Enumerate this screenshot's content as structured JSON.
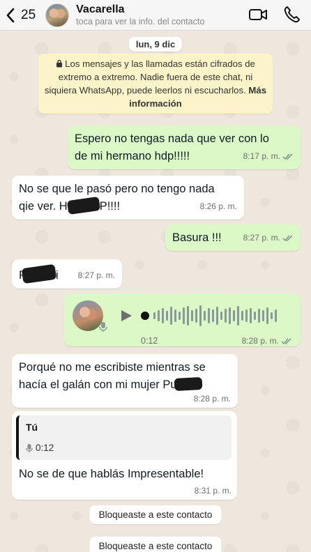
{
  "header": {
    "back_count": "25",
    "contact_name": "Vacarella",
    "contact_subtitle": "toca para ver la info. del contacto"
  },
  "date_separator": "lun, 9 dic",
  "encryption_notice": {
    "text": "Los mensajes y las llamadas están cifrados de extremo a extremo. Nadie fuera de este chat, ni siquiera WhatsApp, puede leerlos ni escucharlos.",
    "link": "Más información"
  },
  "messages": [
    {
      "direction": "out",
      "text_line1": "Espero no tengas nada que ver con lo",
      "text_line2": "de mi hermano hdp!!!!!",
      "time": "8:17 p. m."
    },
    {
      "direction": "in",
      "text_line1": "No se que le pasó pero no tengo nada",
      "text_line2": "qie ver. H",
      "text_tail": "P!!!!",
      "time": "8:26 p. m."
    },
    {
      "direction": "out",
      "text": "Basura !!!",
      "time": "8:27 p. m."
    },
    {
      "direction": "in",
      "text": "P",
      "text_tail": "i",
      "time": "8:27 p. m."
    },
    {
      "direction": "out",
      "type": "voice",
      "duration": "0:12",
      "time": "8:28 p. m."
    },
    {
      "direction": "in",
      "text_line1": "Porqué no me escribiste mientras se",
      "text_line2": "hacía el galán con mi mujer Pu",
      "time": "8:28 p. m."
    },
    {
      "direction": "in",
      "reply_author": "Tú",
      "reply_duration": "0:12",
      "text": "No se de que hablás Impresentable!",
      "time": "8:31 p. m."
    }
  ],
  "system_notices": [
    "Bloqueaste a este contacto",
    "Bloqueaste a este contacto"
  ],
  "colors": {
    "outgoing_bubble": "#dbf8c6",
    "incoming_bubble": "#ffffff",
    "encryption_notice_bg": "#fcf4c9",
    "wallpaper": "#efe7dd"
  }
}
